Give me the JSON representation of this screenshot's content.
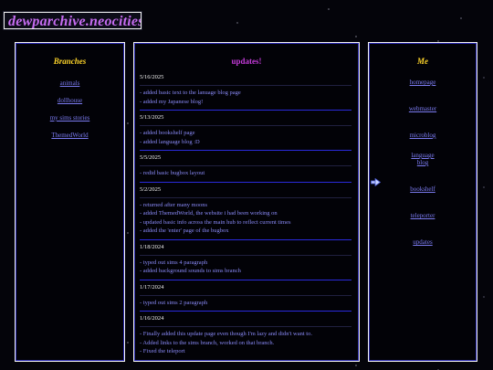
{
  "site": {
    "title": "dewparchive.neocities.org"
  },
  "left": {
    "heading": "Branches",
    "links": [
      "animals",
      "dollhouse",
      "my sims stories",
      "ThemedWorld"
    ]
  },
  "main": {
    "heading": "updates!",
    "entries": [
      {
        "date": "5/16/2025",
        "lines": [
          "- added basic text to the lanuage blog page",
          "- added my Japanese blog!"
        ]
      },
      {
        "date": "5/13/2025",
        "lines": [
          "- added bookshelf page",
          "- added language blog :D"
        ]
      },
      {
        "date": "5/5/2025",
        "lines": [
          "- redid basic bugbox layout"
        ]
      },
      {
        "date": "5/2/2025",
        "lines": [
          "- returned after many moons",
          "- added ThemedWorld, the website i had been working on",
          "- updated basic info across the main hub to reflect current times",
          "- added the 'enter' page of the bugbox"
        ]
      },
      {
        "date": "1/18/2024",
        "lines": [
          "- typed out sims 4 paragraph",
          "- added background sounds to sims branch"
        ]
      },
      {
        "date": "1/17/2024",
        "lines": [
          "- typed out sims 2 paragraph"
        ]
      },
      {
        "date": "1/16/2024",
        "lines": [
          "- Finally added this update page even though I'm lazy and didn't want to.",
          "- Added links to the sims branch, worked on that branch.",
          "- Fixed the teleport"
        ]
      }
    ]
  },
  "right": {
    "heading": "Me",
    "links": [
      "homepage",
      "webmaster",
      "microblog",
      "language blog",
      "bookshelf",
      "teleporter",
      "updates"
    ],
    "current_indicator_icon": "arrow-right-icon"
  }
}
